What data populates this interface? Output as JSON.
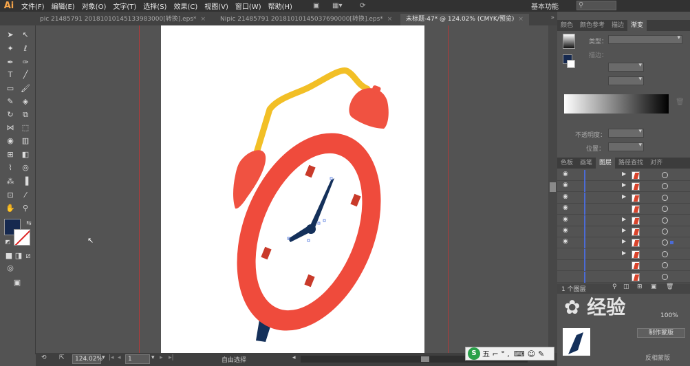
{
  "app": {
    "logo": "Ai"
  },
  "menu": [
    "文件(F)",
    "编辑(E)",
    "对象(O)",
    "文字(T)",
    "选择(S)",
    "效果(C)",
    "视图(V)",
    "窗口(W)",
    "帮助(H)"
  ],
  "workspace": {
    "label": "基本功能",
    "search_placeholder": ""
  },
  "tabs": [
    {
      "label": "pic 21485791 20181010145133983000[转换].eps*",
      "active": false
    },
    {
      "label": "Nipic 21485791 20181010145037690000[转换].eps*",
      "active": false
    },
    {
      "label": "未标题-47* @ 124.02% (CMYK/预览)",
      "active": true
    }
  ],
  "tabs_overflow": "»",
  "tab_close": "×",
  "status": {
    "zoom": "124.02%",
    "page": "1",
    "text": "自由选择"
  },
  "colors": {
    "fill": "#16294f",
    "clock_red": "#ef4b3c",
    "bell_red": "#f05241",
    "handle_yellow": "#f2bf26",
    "hands_navy": "#14305a",
    "accent_blue": "#4b6bd6"
  },
  "gradient_panel": {
    "tabs": [
      "颜色",
      "颜色参考",
      "描边",
      "渐变"
    ],
    "active": "渐变",
    "type_label": "类型：",
    "stroke_label": "描边：",
    "opacity_label": "不透明度：",
    "position_label": "位置："
  },
  "layers_panel": {
    "tabs": [
      "色板",
      "画笔",
      "图层",
      "路径查找",
      "对齐"
    ],
    "active": "图层",
    "footer": "1 个图层",
    "rows": [
      {
        "visible": true,
        "expand": true,
        "selected": false
      },
      {
        "visible": true,
        "expand": true,
        "selected": false
      },
      {
        "visible": true,
        "expand": true,
        "selected": false
      },
      {
        "visible": true,
        "expand": false,
        "selected": false
      },
      {
        "visible": true,
        "expand": true,
        "selected": false
      },
      {
        "visible": true,
        "expand": true,
        "selected": false
      },
      {
        "visible": true,
        "expand": true,
        "selected": true
      },
      {
        "visible": false,
        "expand": true,
        "selected": false
      },
      {
        "visible": false,
        "expand": false,
        "selected": false
      },
      {
        "visible": false,
        "expand": false,
        "selected": false
      }
    ]
  },
  "bottom_panel": {
    "percent": "100%",
    "button": "制作蒙版",
    "checkbox_label": "反相蒙版"
  },
  "ime": {
    "logo": "S",
    "text": "五 ⌐ ° ,"
  }
}
